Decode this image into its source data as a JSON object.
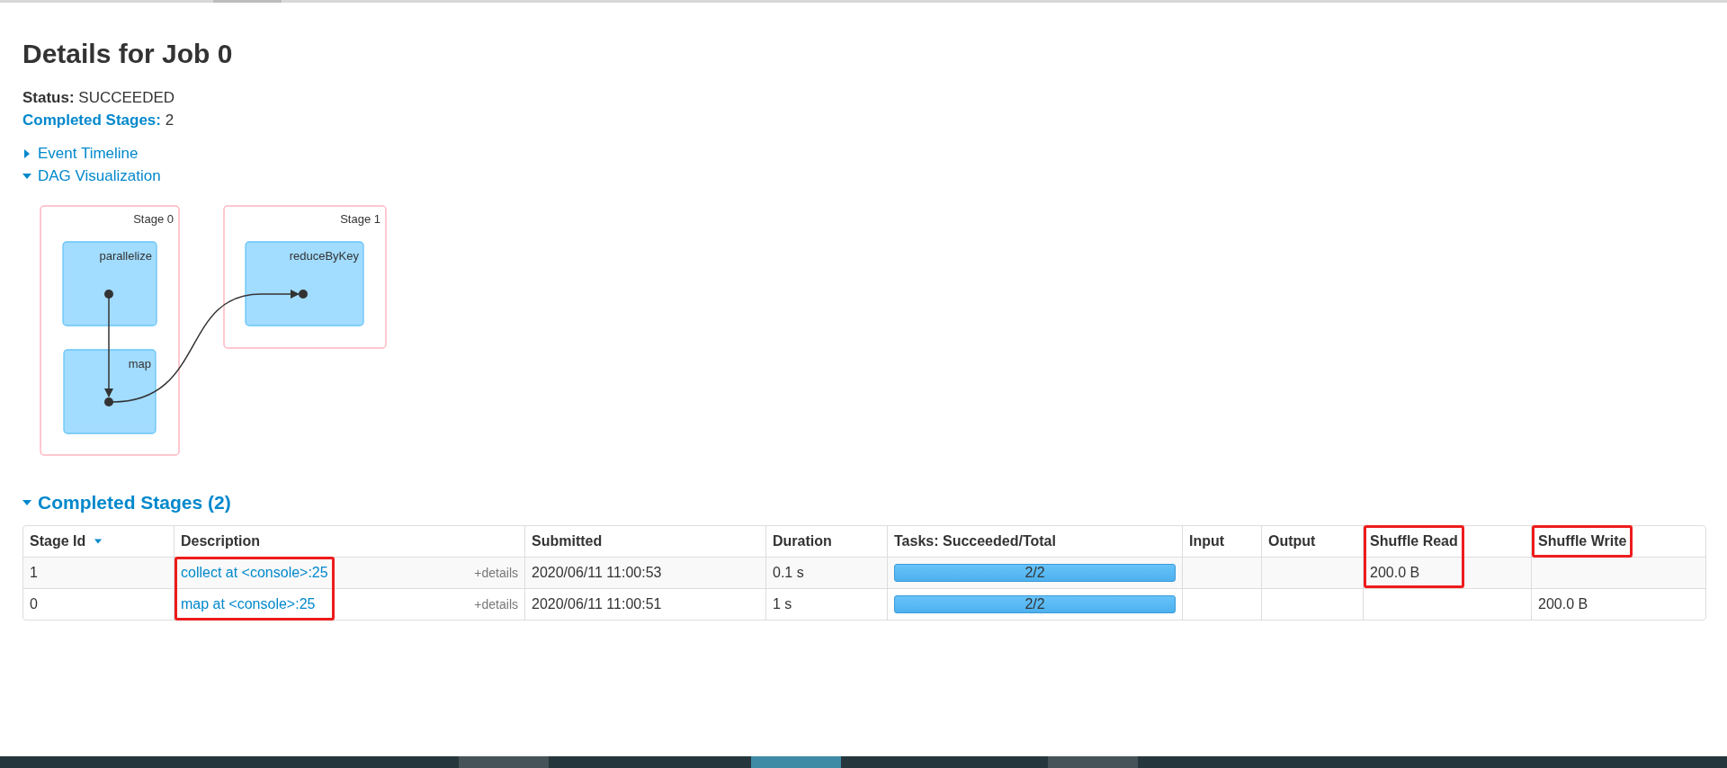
{
  "title": "Details for Job 0",
  "summary": [
    {
      "label": "Status:",
      "value": "SUCCEEDED",
      "kind": "plain"
    },
    {
      "label": "Completed Stages:",
      "value": "2",
      "kind": "link"
    }
  ],
  "toggles": [
    {
      "label": "Event Timeline",
      "expanded": false
    },
    {
      "label": "DAG Visualization",
      "expanded": true
    }
  ],
  "dag": {
    "stages": [
      {
        "label": "Stage 0",
        "nodes": [
          {
            "label": "parallelize"
          },
          {
            "label": "map"
          }
        ]
      },
      {
        "label": "Stage 1",
        "nodes": [
          {
            "label": "reduceByKey"
          }
        ]
      }
    ]
  },
  "section": {
    "label": "Completed Stages (2)",
    "expanded": true
  },
  "table": {
    "columns": [
      {
        "label": "Stage Id",
        "sorted": true,
        "boxed": false
      },
      {
        "label": "Description",
        "sorted": false,
        "boxed": false
      },
      {
        "label": "Submitted",
        "sorted": false,
        "boxed": false
      },
      {
        "label": "Duration",
        "sorted": false,
        "boxed": false
      },
      {
        "label": "Tasks: Succeeded/Total",
        "sorted": false,
        "boxed": false
      },
      {
        "label": "Input",
        "sorted": false,
        "boxed": false
      },
      {
        "label": "Output",
        "sorted": false,
        "boxed": false
      },
      {
        "label": "Shuffle Read",
        "sorted": false,
        "boxed": true
      },
      {
        "label": "Shuffle Write",
        "sorted": false,
        "boxed": true
      }
    ],
    "rows": [
      {
        "cells": [
          {
            "kind": "text",
            "text": "1"
          },
          {
            "kind": "link",
            "text": "collect at <console>:25",
            "extra": "+details",
            "boxed": true
          },
          {
            "kind": "text",
            "text": "2020/06/11 11:00:53"
          },
          {
            "kind": "text",
            "text": "0.1 s"
          },
          {
            "kind": "progress",
            "text": "2/2",
            "level": 1
          },
          {
            "kind": "empty"
          },
          {
            "kind": "empty"
          },
          {
            "kind": "text",
            "text": "200.0 B",
            "boxed": true
          },
          {
            "kind": "empty"
          }
        ]
      },
      {
        "cells": [
          {
            "kind": "text",
            "text": "0"
          },
          {
            "kind": "link",
            "text": "map at <console>:25",
            "extra": "+details",
            "boxed": true
          },
          {
            "kind": "text",
            "text": "2020/06/11 11:00:51"
          },
          {
            "kind": "text",
            "text": "1 s"
          },
          {
            "kind": "progress",
            "text": "2/2",
            "level": 1
          },
          {
            "kind": "empty"
          },
          {
            "kind": "empty"
          },
          {
            "kind": "empty"
          },
          {
            "kind": "text",
            "text": "200.0 B"
          }
        ]
      }
    ]
  },
  "taskbar": {
    "buttons": [
      {
        "active": false
      },
      {
        "active": true
      },
      {
        "active": false
      }
    ]
  }
}
